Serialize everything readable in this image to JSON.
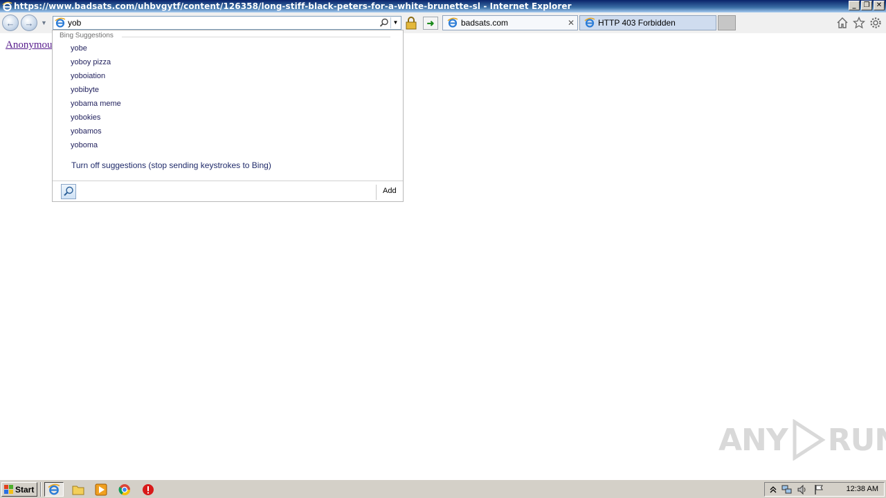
{
  "window": {
    "title": "https://www.badsats.com/uhbvgytf/content/126358/long-stiff-black-peters-for-a-white-brunette-sl - Internet Explorer",
    "min_glyph": "_",
    "max_glyph": "❐",
    "close_glyph": "✕"
  },
  "nav": {
    "back_glyph": "←",
    "fwd_glyph": "→",
    "address_value": "yob",
    "go_glyph": "➜"
  },
  "tabs": [
    {
      "label": "badsats.com",
      "close_glyph": "✕"
    },
    {
      "label": "HTTP 403 Forbidden"
    }
  ],
  "page": {
    "link_text": "Anonymou"
  },
  "suggestions": {
    "header": "Bing Suggestions",
    "items": [
      "yobe",
      "yoboy pizza",
      "yoboiation",
      "yobibyte",
      "yobama meme",
      "yobokies",
      "yobamos",
      "yoboma"
    ],
    "turn_off": "Turn off suggestions (stop sending keystrokes to Bing)",
    "add_label": "Add"
  },
  "taskbar": {
    "start_label": "Start",
    "clock": "12:38 AM"
  },
  "watermark": {
    "left": "ANY",
    "right": "RUN"
  },
  "colors": {
    "titlebar": "#0a246a",
    "link_visited": "#551a8b",
    "suggestion_text": "#1f1f5c"
  }
}
